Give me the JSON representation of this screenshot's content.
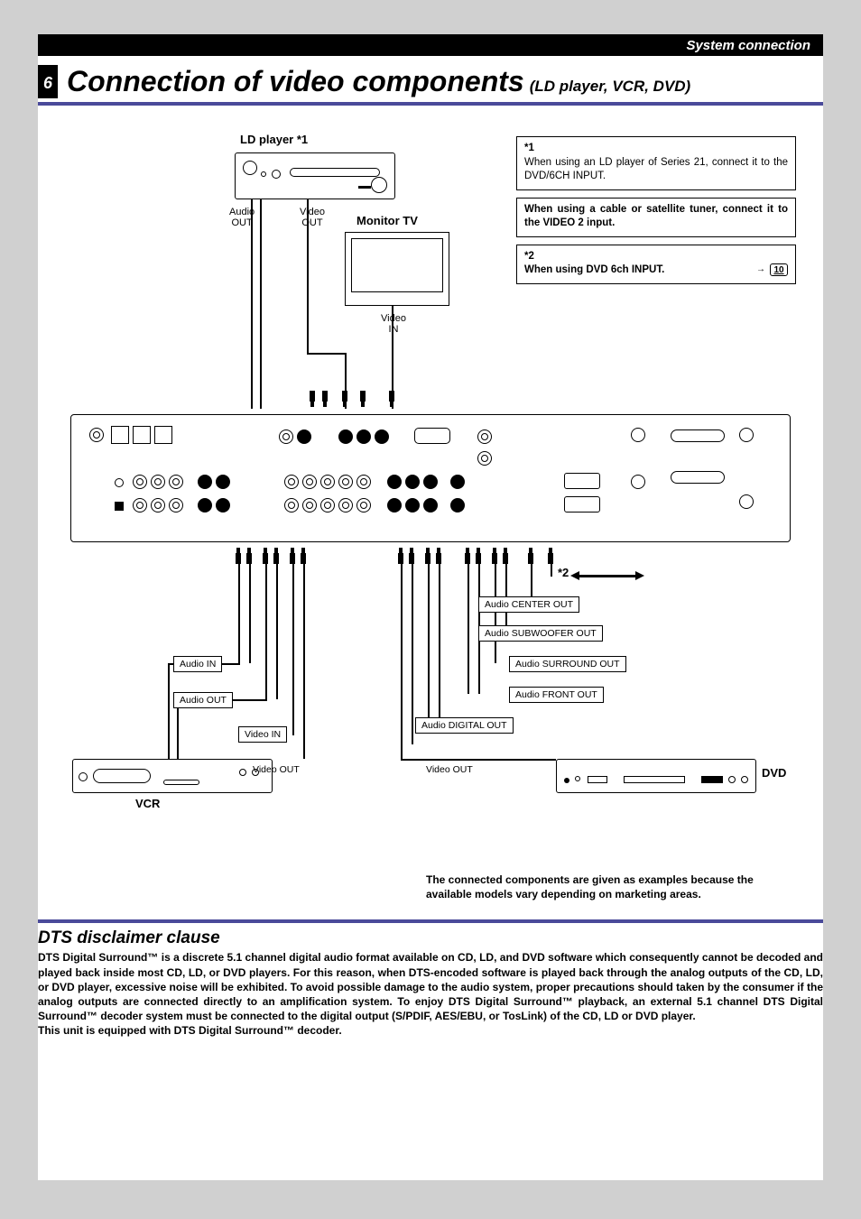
{
  "header": {
    "section": "System connection"
  },
  "page_number": "6",
  "title": {
    "main": "Connection of video components",
    "sub": "(LD player, VCR, DVD)"
  },
  "diagram": {
    "ld_player_label": "LD player *1",
    "audio_out": "Audio\nOUT",
    "video_out": "Video\nOUT",
    "monitor_tv": "Monitor TV",
    "video_in": "Video\nIN",
    "asterisk2": "*2",
    "vcr": {
      "label": "VCR",
      "audio_in": "Audio IN",
      "audio_out": "Audio OUT",
      "video_in": "Video IN",
      "video_out": "Video OUT"
    },
    "dvd": {
      "label": "DVD",
      "audio_center": "Audio CENTER OUT",
      "audio_sub": "Audio SUBWOOFER OUT",
      "audio_surround": "Audio SURROUND OUT",
      "audio_front": "Audio FRONT OUT",
      "audio_digital": "Audio DIGITAL OUT",
      "video_out": "Video OUT"
    }
  },
  "notes": {
    "n1_head": "*1",
    "n1_body": "When using an LD player of Series 21, connect it to the DVD/6CH INPUT.",
    "n2_body": "When using a cable or satellite tuner, connect it to the VIDEO 2 input.",
    "n3_head": "*2",
    "n3_body": "When using DVD 6ch INPUT.",
    "n3_page_ref": "10"
  },
  "example_note": "The connected components are given as examples because the available models vary depending on marketing areas.",
  "dts": {
    "title": "DTS disclaimer clause",
    "body": "DTS Digital Surround™ is a discrete 5.1 channel digital audio format available on CD, LD, and DVD software which consequently cannot be decoded and played back inside most CD, LD, or DVD players. For this reason, when DTS-encoded software is played back through the analog outputs of the CD, LD, or DVD player, excessive noise will be exhibited. To avoid possible damage to the audio system, proper precautions should taken by the consumer if the analog outputs are connected directly to an amplification system. To enjoy DTS Digital Surround™ playback, an external 5.1 channel DTS Digital Surround™ decoder system must be connected to the digital output (S/PDIF, AES/EBU, or TosLink) of the CD, LD or DVD player.",
    "equipped": "This unit is equipped with DTS Digital Surround™ decoder."
  }
}
